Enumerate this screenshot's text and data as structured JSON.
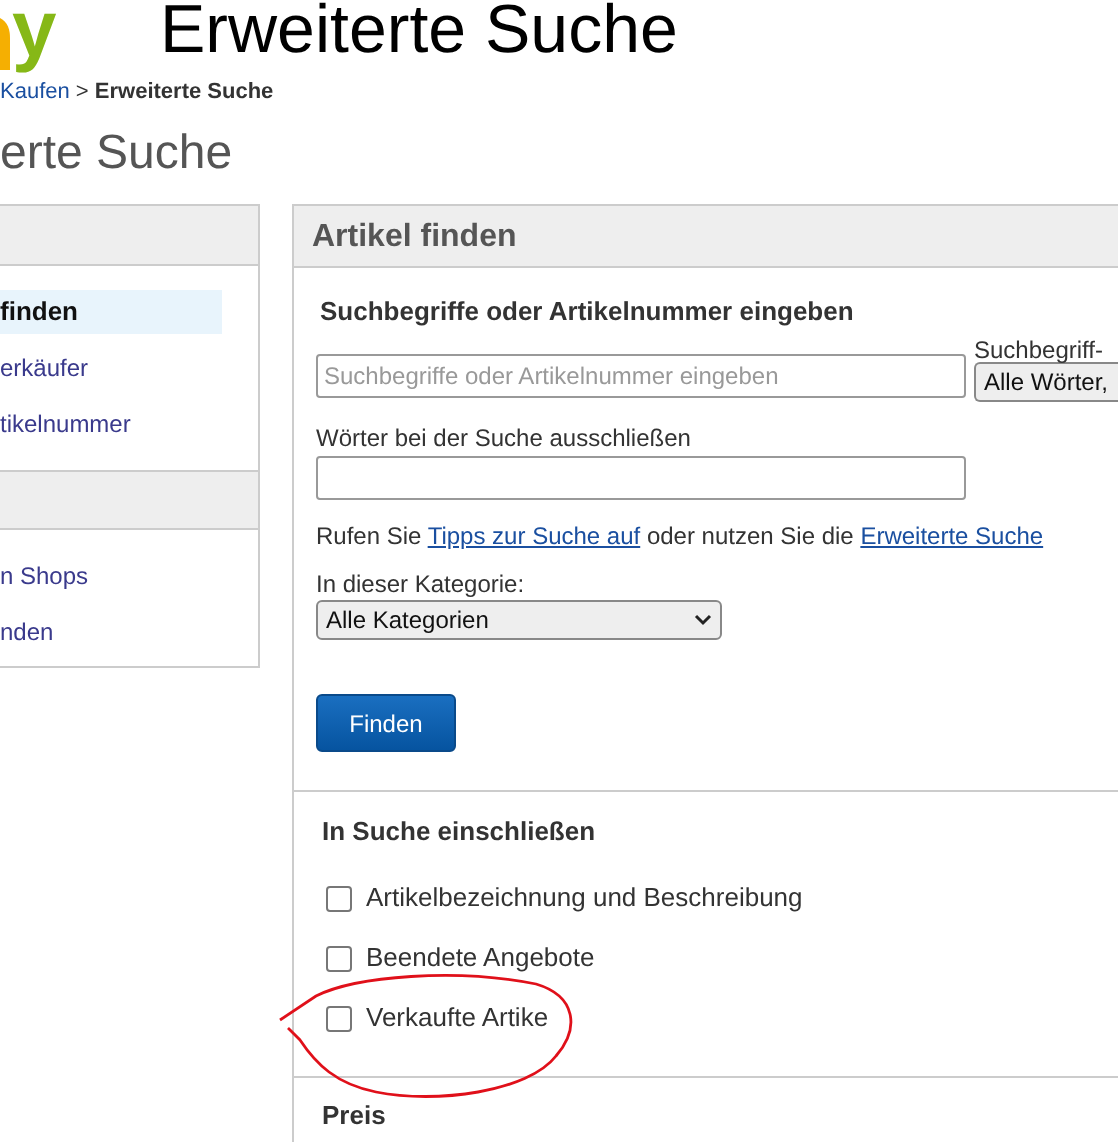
{
  "logo": {
    "text": "y"
  },
  "page_title": "Erweiterte Suche",
  "breadcrumb": {
    "parent": "Kaufen",
    "separator": ">",
    "current": "Erweiterte Suche"
  },
  "heading": "erte Suche",
  "sidebar": {
    "sections": [
      {
        "items": [
          {
            "label": "finden",
            "selected": true
          },
          {
            "label": "erkäufer",
            "selected": false
          },
          {
            "label": "tikelnummer",
            "selected": false
          }
        ]
      },
      {
        "items": [
          {
            "label": "n Shops",
            "selected": false
          },
          {
            "label": "nden",
            "selected": false
          }
        ]
      }
    ]
  },
  "panel": {
    "title": "Artikel finden",
    "keywords": {
      "label": "Suchbegriffe oder Artikelnummer eingeben",
      "placeholder": "Suchbegriffe oder Artikelnummer eingeben",
      "option_label": "Suchbegriff-",
      "option_value": "Alle Wörter,"
    },
    "exclude": {
      "label": "Wörter bei der Suche ausschließen"
    },
    "tips": [
      {
        "kind": "text",
        "text": "Rufen Sie "
      },
      {
        "kind": "link",
        "text": "Tipps zur Suche auf"
      },
      {
        "kind": "text",
        "text": " oder nutzen Sie die "
      },
      {
        "kind": "link",
        "text": "Erweiterte Suche"
      }
    ],
    "category": {
      "label": "In dieser Kategorie:",
      "value": "Alle Kategorien"
    },
    "find_button": "Finden",
    "include": {
      "title": "In Suche einschließen",
      "options": [
        {
          "label": "Artikelbezeichnung und Beschreibung",
          "checked": false
        },
        {
          "label": "Beendete Angebote",
          "checked": false
        },
        {
          "label": "Verkaufte Artike",
          "checked": false
        }
      ]
    },
    "price": {
      "title": "Preis"
    }
  }
}
